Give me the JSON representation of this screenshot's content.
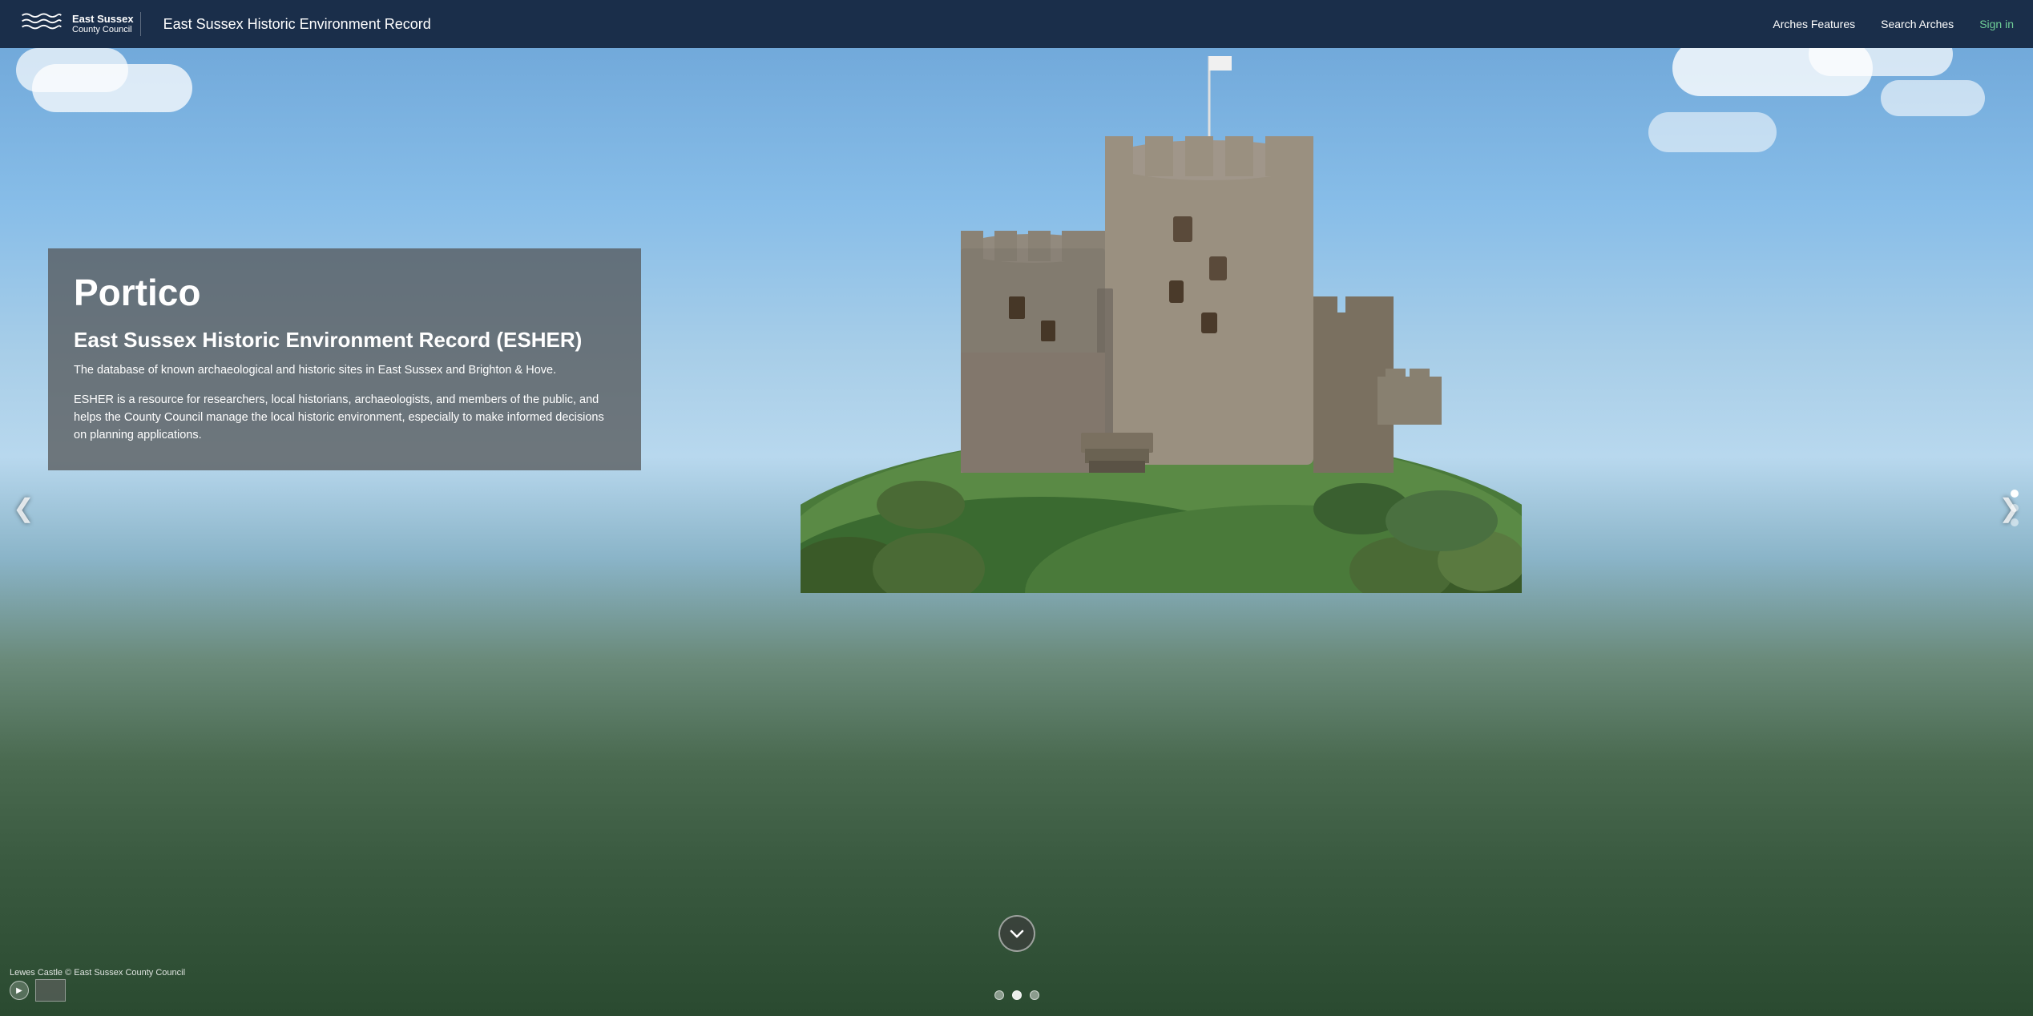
{
  "navbar": {
    "logo_line1": "East Sussex",
    "logo_line2": "County Council",
    "site_title": "East Sussex Historic Environment Record",
    "links": {
      "arches_features": "Arches Features",
      "search_arches": "Search Arches",
      "sign_in": "Sign in"
    }
  },
  "hero": {
    "slide_title": "Portico",
    "subtitle": "East Sussex Historic Environment Record (ESHER)",
    "description1": "The database of known archaeological and historic sites in East Sussex and Brighton & Hove.",
    "description2": "ESHER is a resource for researchers, local historians, archaeologists, and members of the public, and helps the County Council manage the local historic environment, especially to make informed decisions on planning applications.",
    "photo_credit": "Lewes Castle © East Sussex County Council",
    "scroll_down_icon": "chevron-down",
    "prev_arrow": "❮",
    "next_arrow": "❯"
  },
  "pagination": {
    "total_slides": 3,
    "active_slide": 1,
    "side_dots": 3,
    "active_side_dot": 0
  }
}
